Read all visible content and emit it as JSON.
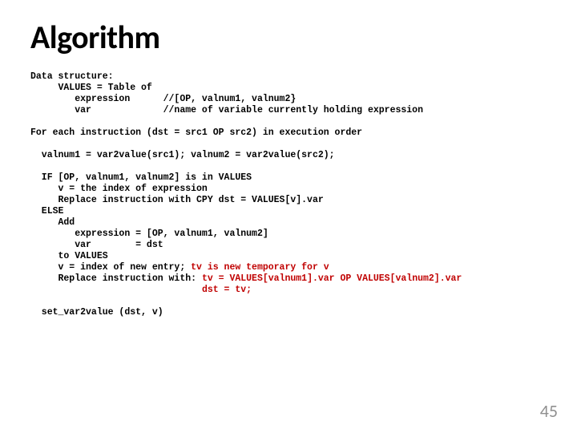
{
  "title": "Algorithm",
  "code": {
    "l01": "Data structure:",
    "l02": "     VALUES = Table of",
    "l03": "        expression      //[OP, valnum1, valnum2}",
    "l04": "        var             //name of variable currently holding expression",
    "l05": "",
    "l06": "For each instruction (dst = src1 OP src2) in execution order",
    "l07": "",
    "l08": "  valnum1 = var2value(src1); valnum2 = var2value(src2);",
    "l09": "",
    "l10": "  IF [OP, valnum1, valnum2] is in VALUES",
    "l11": "     v = the index of expression",
    "l12": "     Replace instruction with CPY dst = VALUES[v].var",
    "l13": "  ELSE",
    "l14": "     Add",
    "l15": "        expression = [OP, valnum1, valnum2]",
    "l16": "        var        = dst",
    "l17": "     to VALUES",
    "l18a": "     v = index of new entry;",
    "l18b": " tv is new temporary for v",
    "l19a": "     Replace instruction with:",
    "l19b": " tv = VALUES[valnum1].var OP VALUES[valnum2].var",
    "l20a": "                              ",
    "l20b": " dst = tv;",
    "l21": "",
    "l22": "  set_var2value (dst, v)"
  },
  "pagenum": "45"
}
